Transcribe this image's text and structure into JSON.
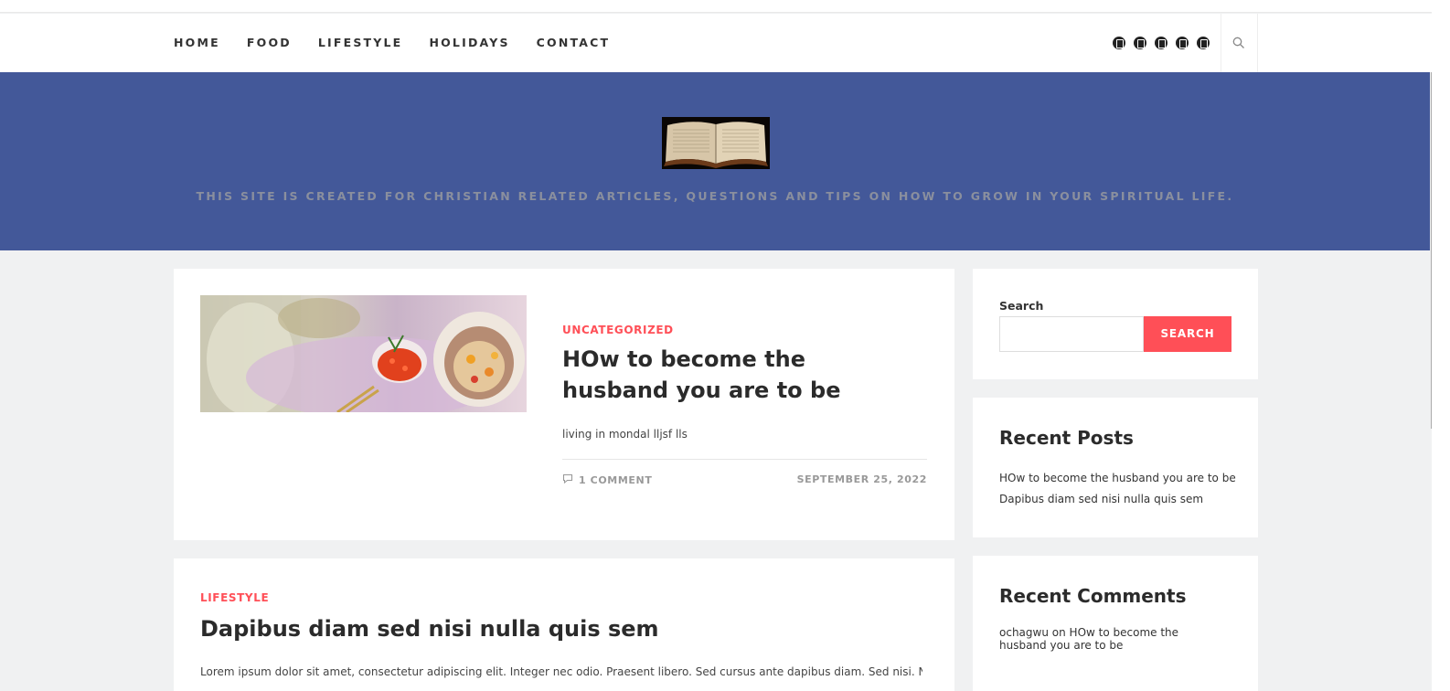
{
  "nav": {
    "items": [
      "HOME",
      "FOOD",
      "LIFESTYLE",
      "HOLIDAYS",
      "CONTACT"
    ],
    "social_icons": [
      "social-icon-1",
      "social-icon-2",
      "social-icon-3",
      "social-icon-4",
      "social-icon-5"
    ],
    "search_icon": "search-icon"
  },
  "hero": {
    "logo": "open-bible-image",
    "tagline": "THIS SITE IS CREATED FOR CHRISTIAN RELATED ARTICLES, QUESTIONS AND TIPS ON HOW TO GROW IN YOUR SPIRITUAL LIFE.",
    "background": "#435899"
  },
  "posts": [
    {
      "category": "UNCATEGORIZED",
      "title": "HOw to become the husband you are to be",
      "excerpt": "living in mondal lljsf lls",
      "comments": "1 COMMENT",
      "date": "SEPTEMBER 25, 2022",
      "thumbnail": "oyster-caviar-image"
    },
    {
      "category": "LIFESTYLE",
      "title": "Dapibus diam sed nisi nulla quis sem",
      "excerpt": "Lorem ipsum dolor sit amet, consectetur adipiscing elit. Integer nec odio. Praesent libero. Sed cursus ante dapibus diam. Sed nisi. Nulla"
    }
  ],
  "sidebar": {
    "search": {
      "label": "Search",
      "button": "SEARCH",
      "value": ""
    },
    "recent_posts": {
      "title": "Recent Posts",
      "items": [
        "HOw to become the husband you are to be",
        "Dapibus diam sed nisi nulla quis sem"
      ]
    },
    "recent_comments": {
      "title": "Recent Comments",
      "author": "ochagwu",
      "on": "on",
      "post": "HOw to become the husband you are to be"
    }
  },
  "colors": {
    "accent": "#ff4f57",
    "hero": "#435899",
    "background": "#f0f1f2"
  }
}
